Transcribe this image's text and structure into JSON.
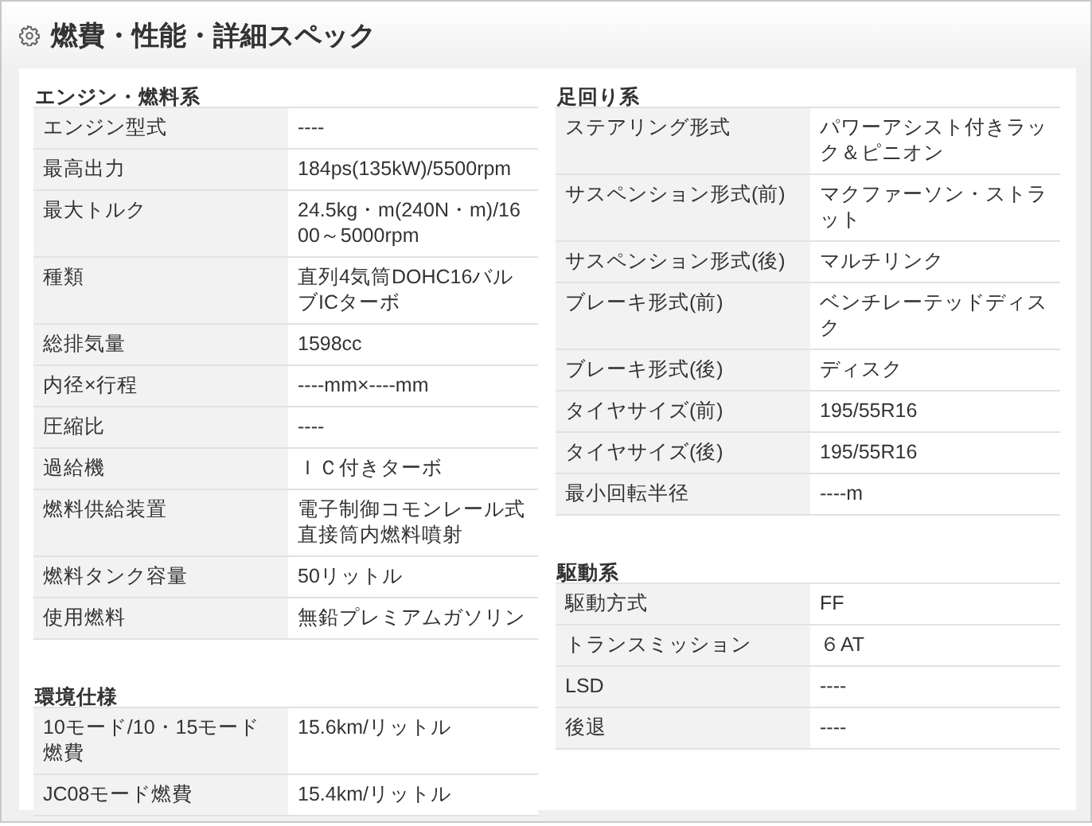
{
  "header": {
    "title": "燃費・性能・詳細スペック"
  },
  "columns": [
    {
      "sections": [
        {
          "title": "エンジン・燃料系",
          "rows": [
            {
              "label": "エンジン型式",
              "value": "----"
            },
            {
              "label": "最高出力",
              "value": "184ps(135kW)/5500rpm"
            },
            {
              "label": "最大トルク",
              "value": "24.5kg・m(240N・m)/1600～5000rpm"
            },
            {
              "label": "種類",
              "value": "直列4気筒DOHC16バルブICターボ"
            },
            {
              "label": "総排気量",
              "value": "1598cc"
            },
            {
              "label": "内径×行程",
              "value": "----mm×----mm"
            },
            {
              "label": "圧縮比",
              "value": "----"
            },
            {
              "label": "過給機",
              "value": "ＩＣ付きターボ"
            },
            {
              "label": "燃料供給装置",
              "value": "電子制御コモンレール式直接筒内燃料噴射"
            },
            {
              "label": "燃料タンク容量",
              "value": "50リットル"
            },
            {
              "label": "使用燃料",
              "value": "無鉛プレミアムガソリン"
            }
          ]
        },
        {
          "title": "環境仕様",
          "rows": [
            {
              "label": "10モード/10・15モード燃費",
              "value": "15.6km/リットル"
            },
            {
              "label": "JC08モード燃費",
              "value": "15.4km/リットル"
            }
          ]
        }
      ]
    },
    {
      "sections": [
        {
          "title": "足回り系",
          "rows": [
            {
              "label": "ステアリング形式",
              "value": "パワーアシスト付きラック＆ピニオン"
            },
            {
              "label": "サスペンション形式(前)",
              "value": "マクファーソン・ストラット"
            },
            {
              "label": "サスペンション形式(後)",
              "value": "マルチリンク"
            },
            {
              "label": "ブレーキ形式(前)",
              "value": "ベンチレーテッドディスク"
            },
            {
              "label": "ブレーキ形式(後)",
              "value": "ディスク"
            },
            {
              "label": "タイヤサイズ(前)",
              "value": "195/55R16"
            },
            {
              "label": "タイヤサイズ(後)",
              "value": "195/55R16"
            },
            {
              "label": "最小回転半径",
              "value": "----m"
            }
          ]
        },
        {
          "title": "駆動系",
          "rows": [
            {
              "label": "駆動方式",
              "value": "FF"
            },
            {
              "label": "トランスミッション",
              "value": "６AT"
            },
            {
              "label": "LSD",
              "value": "----"
            },
            {
              "label": "後退",
              "value": "----"
            }
          ]
        }
      ]
    }
  ]
}
